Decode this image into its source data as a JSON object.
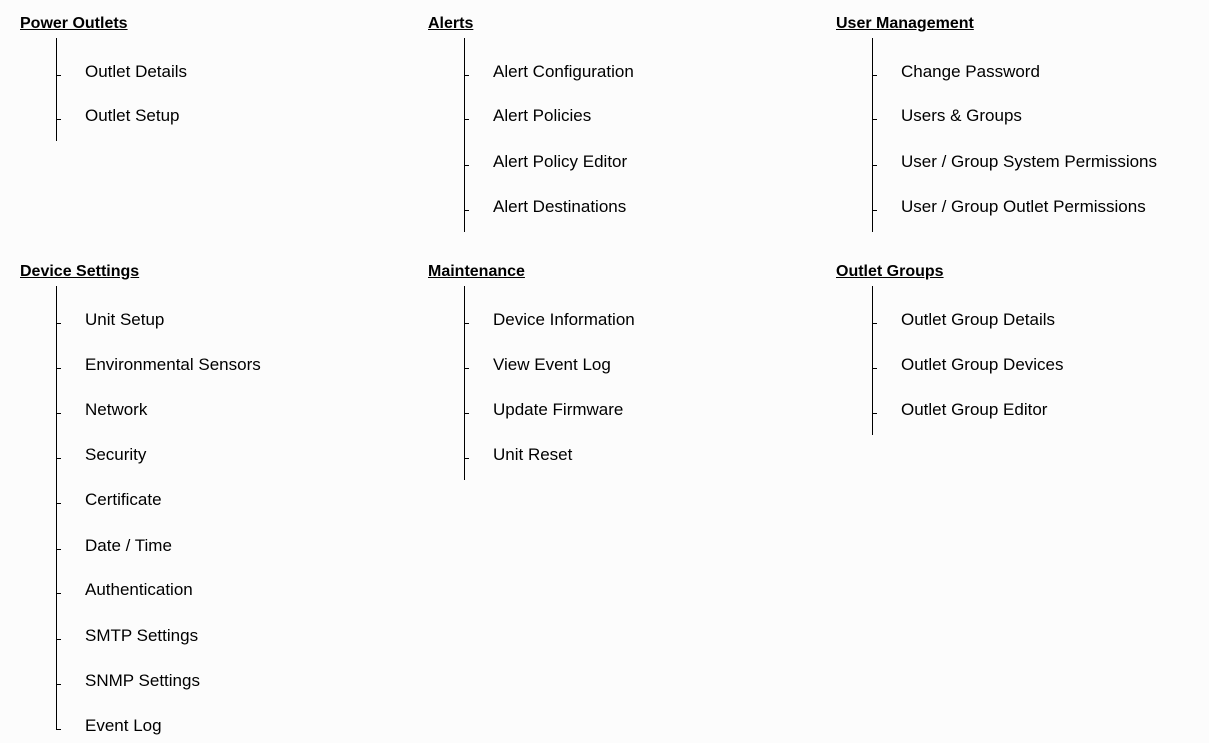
{
  "sections": {
    "power_outlets": {
      "title": "Power Outlets",
      "items": [
        "Outlet Details",
        "Outlet Setup"
      ]
    },
    "alerts": {
      "title": "Alerts",
      "items": [
        "Alert Configuration",
        "Alert Policies",
        "Alert Policy Editor",
        "Alert Destinations"
      ]
    },
    "user_management": {
      "title": "User Management",
      "items": [
        "Change Password",
        "Users & Groups",
        "User / Group System Permissions",
        "User / Group Outlet Permissions"
      ]
    },
    "device_settings": {
      "title": "Device Settings",
      "items": [
        "Unit Setup",
        "Environmental Sensors",
        "Network",
        "Security",
        "Certificate",
        "Date / Time",
        "Authentication",
        "SMTP Settings",
        "SNMP Settings",
        "Event Log"
      ]
    },
    "maintenance": {
      "title": "Maintenance",
      "items": [
        "Device Information",
        "View Event Log",
        "Update Firmware",
        "Unit Reset"
      ]
    },
    "outlet_groups": {
      "title": "Outlet Groups",
      "items": [
        "Outlet Group Details",
        "Outlet Group Devices",
        "Outlet Group Editor"
      ]
    }
  }
}
